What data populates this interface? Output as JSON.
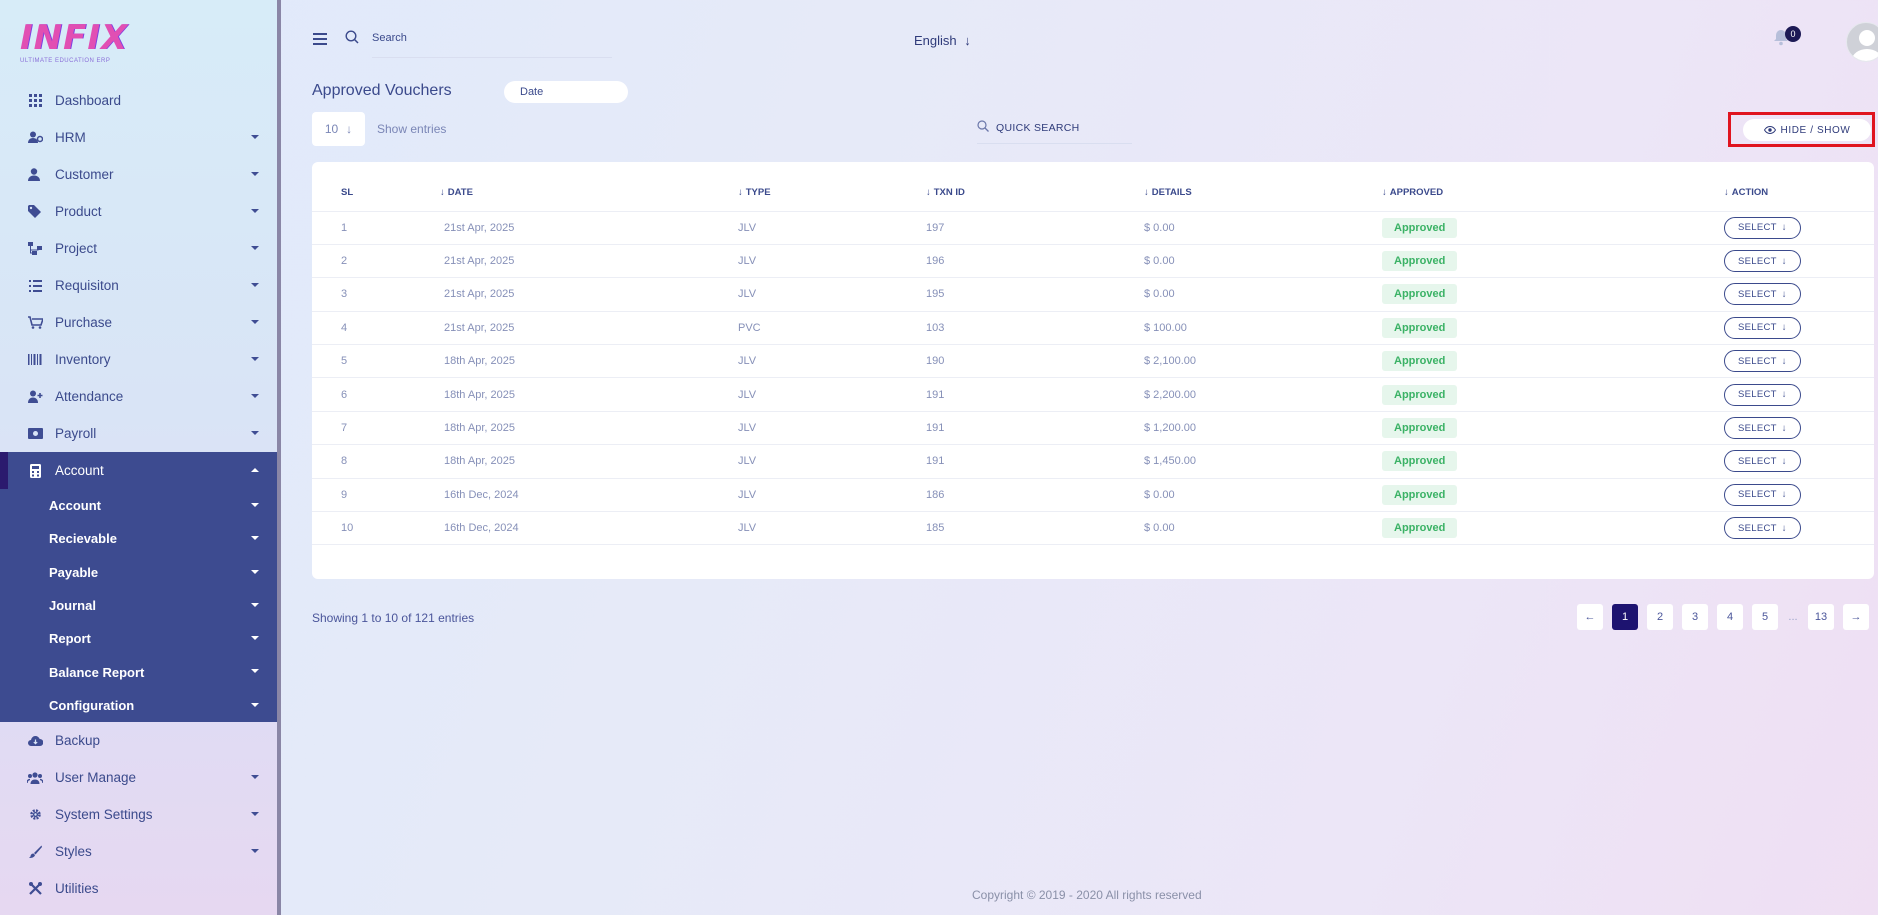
{
  "brand": {
    "logo": "INFIX",
    "tagline": "ULTIMATE EDUCATION ERP"
  },
  "sidebar": {
    "items": [
      {
        "label": "Dashboard",
        "icon": "grid-icon"
      },
      {
        "label": "HRM",
        "icon": "users-gear-icon"
      },
      {
        "label": "Customer",
        "icon": "user-icon"
      },
      {
        "label": "Product",
        "icon": "tags-icon"
      },
      {
        "label": "Project",
        "icon": "hierarchy-icon"
      },
      {
        "label": "Requisiton",
        "icon": "list-icon"
      },
      {
        "label": "Purchase",
        "icon": "cart-icon"
      },
      {
        "label": "Inventory",
        "icon": "barcode-icon"
      },
      {
        "label": "Attendance",
        "icon": "user-plus-icon"
      },
      {
        "label": "Payroll",
        "icon": "money-icon"
      },
      {
        "label": "Account",
        "icon": "calculator-icon"
      }
    ],
    "account_sub": [
      "Account",
      "Recievable",
      "Payable",
      "Journal",
      "Report",
      "Balance Report",
      "Configuration"
    ],
    "bottom_items": [
      {
        "label": "Backup",
        "icon": "cloud-download-icon"
      },
      {
        "label": "User Manage",
        "icon": "users-icon"
      },
      {
        "label": "System Settings",
        "icon": "gear-icon"
      },
      {
        "label": "Styles",
        "icon": "brush-icon"
      },
      {
        "label": "Utilities",
        "icon": "tools-icon"
      }
    ]
  },
  "topbar": {
    "search_label": "Search",
    "language": "English",
    "notification_count": "0"
  },
  "page": {
    "title": "Approved Vouchers",
    "date_filter": "Date",
    "entries_value": "10",
    "entries_label": "Show entries",
    "quick_search": "QUICK SEARCH",
    "hide_show": "HIDE / SHOW"
  },
  "table": {
    "columns": [
      "SL",
      "DATE",
      "TYPE",
      "TXN ID",
      "DETAILS",
      "APPROVED",
      "ACTION"
    ],
    "rows": [
      {
        "sl": "1",
        "date": "21st Apr, 2025",
        "type": "JLV",
        "txn": "197",
        "details": "$ 0.00",
        "approved": "Approved",
        "action": "SELECT"
      },
      {
        "sl": "2",
        "date": "21st Apr, 2025",
        "type": "JLV",
        "txn": "196",
        "details": "$ 0.00",
        "approved": "Approved",
        "action": "SELECT"
      },
      {
        "sl": "3",
        "date": "21st Apr, 2025",
        "type": "JLV",
        "txn": "195",
        "details": "$ 0.00",
        "approved": "Approved",
        "action": "SELECT"
      },
      {
        "sl": "4",
        "date": "21st Apr, 2025",
        "type": "PVC",
        "txn": "103",
        "details": "$ 100.00",
        "approved": "Approved",
        "action": "SELECT"
      },
      {
        "sl": "5",
        "date": "18th Apr, 2025",
        "type": "JLV",
        "txn": "190",
        "details": "$ 2,100.00",
        "approved": "Approved",
        "action": "SELECT"
      },
      {
        "sl": "6",
        "date": "18th Apr, 2025",
        "type": "JLV",
        "txn": "191",
        "details": "$ 2,200.00",
        "approved": "Approved",
        "action": "SELECT"
      },
      {
        "sl": "7",
        "date": "18th Apr, 2025",
        "type": "JLV",
        "txn": "191",
        "details": "$ 1,200.00",
        "approved": "Approved",
        "action": "SELECT"
      },
      {
        "sl": "8",
        "date": "18th Apr, 2025",
        "type": "JLV",
        "txn": "191",
        "details": "$ 1,450.00",
        "approved": "Approved",
        "action": "SELECT"
      },
      {
        "sl": "9",
        "date": "16th Dec, 2024",
        "type": "JLV",
        "txn": "186",
        "details": "$ 0.00",
        "approved": "Approved",
        "action": "SELECT"
      },
      {
        "sl": "10",
        "date": "16th Dec, 2024",
        "type": "JLV",
        "txn": "185",
        "details": "$ 0.00",
        "approved": "Approved",
        "action": "SELECT"
      }
    ]
  },
  "footer": {
    "showing": "Showing 1 to 10 of 121 entries",
    "pages": [
      "1",
      "2",
      "3",
      "4",
      "5",
      "...",
      "13"
    ],
    "copyright": "Copyright © 2019 - 2020 All rights reserved"
  },
  "colors": {
    "accent": "#3d4b90",
    "active_page": "#1d1370",
    "approved": "#3ab265",
    "highlight": "#e0141f"
  }
}
